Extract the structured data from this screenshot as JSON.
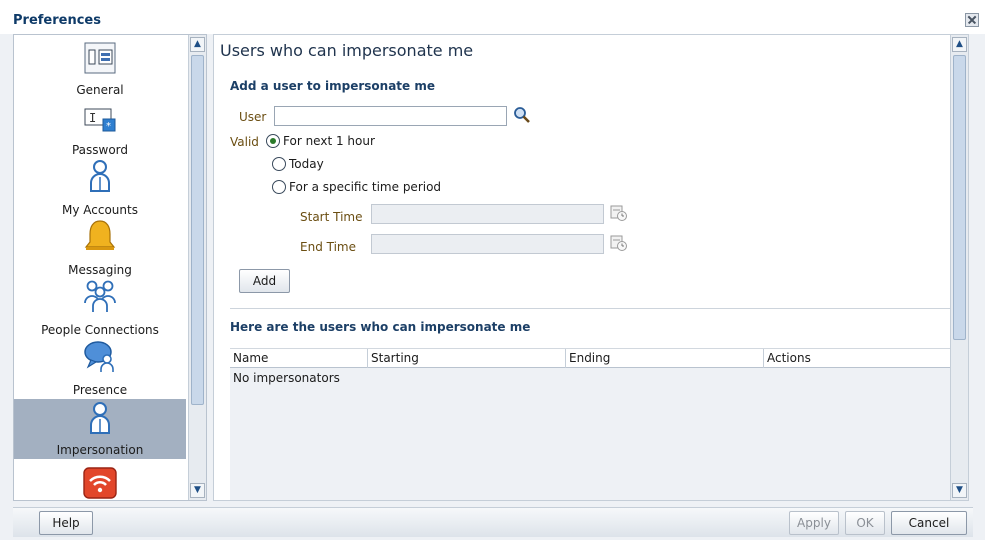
{
  "dialog": {
    "title": "Preferences"
  },
  "nav": {
    "items": [
      {
        "label": "General",
        "icon": "general-settings-icon"
      },
      {
        "label": "Password",
        "icon": "password-icon"
      },
      {
        "label": "My Accounts",
        "icon": "user-icon"
      },
      {
        "label": "Messaging",
        "icon": "bell-icon"
      },
      {
        "label": "People Connections",
        "icon": "people-icon"
      },
      {
        "label": "Presence",
        "icon": "presence-icon"
      },
      {
        "label": "Impersonation",
        "icon": "user-icon",
        "selected": true
      },
      {
        "label": "",
        "icon": "wireless-icon"
      }
    ]
  },
  "main": {
    "title": "Users who can impersonate me",
    "add_section": {
      "title": "Add a user to impersonate me",
      "user_label": "User",
      "user_value": "",
      "valid_label": "Valid",
      "options": [
        "For next 1 hour",
        "Today",
        "For a specific time period"
      ],
      "selected_option": 0,
      "start_label": "Start Time",
      "end_label": "End Time",
      "add_button": "Add"
    },
    "list_section": {
      "title": "Here are the users who can impersonate me",
      "columns": [
        "Name",
        "Starting",
        "Ending",
        "Actions"
      ],
      "empty_message": "No impersonators"
    }
  },
  "footer": {
    "help": "Help",
    "apply": "Apply",
    "ok": "OK",
    "cancel": "Cancel"
  },
  "colors": {
    "title": "#0e3a68",
    "selected_nav": "#a3b0c1",
    "field_label": "#6b4e12",
    "section_title": "#1c3f66"
  }
}
